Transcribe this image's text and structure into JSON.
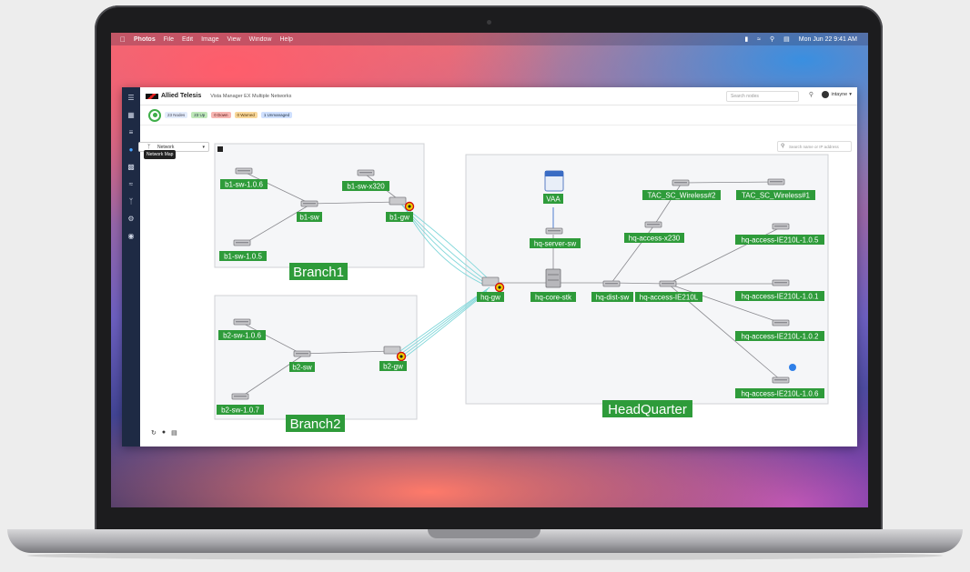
{
  "menubar": {
    "app": "Photos",
    "items": [
      "File",
      "Edit",
      "Image",
      "View",
      "Window",
      "Help"
    ],
    "clock": "Mon Jun 22  9:41 AM"
  },
  "app": {
    "brand": "Allied Telesis",
    "breadcrumb": "Vista Manager EX   Multiple Networks",
    "search_placeholder": "Search nodes",
    "user": "intayne",
    "chips": [
      "23 Nodes",
      "23 Up",
      "0 Down",
      "0 Warned",
      "1 Unmanaged"
    ],
    "view_selector": "Network",
    "tooltip": "Network Map",
    "map_search_placeholder": "Search name or IP address"
  },
  "groups": {
    "branch1": "Branch1",
    "branch2": "Branch2",
    "hq": "HeadQuarter"
  },
  "nodes": {
    "b1_sw_106": "b1-sw-1.0.6",
    "b1_sw_x320": "b1-sw-x320",
    "b1_sw": "b1-sw",
    "b1_gw": "b1-gw",
    "b1_sw_105": "b1-sw-1.0.5",
    "b2_sw_106": "b2-sw-1.0.6",
    "b2_sw": "b2-sw",
    "b2_gw": "b2-gw",
    "b2_sw_107": "b2-sw-1.0.7",
    "hq_gw": "hq-gw",
    "vaa": "VAA",
    "hq_server_sw": "hq-server-sw",
    "hq_core_stk": "hq-core-stk",
    "hq_dist_sw": "hq-dist-sw",
    "hq_access_x230": "hq-access-x230",
    "tac_2": "TAC_SC_Wireless#2",
    "tac_1": "TAC_SC_Wireless#1",
    "hq_access_ie210l": "hq-access-IE210L",
    "ie_105": "hq-access-IE210L-1.0.5",
    "ie_101": "hq-access-IE210L-1.0.1",
    "ie_102": "hq-access-IE210L-1.0.2",
    "ie_106": "hq-access-IE210L-1.0.6"
  },
  "colors": {
    "label_bg": "#2e9b3a",
    "uplink": "#7fd6d9",
    "sidebar": "#1e2a44"
  }
}
